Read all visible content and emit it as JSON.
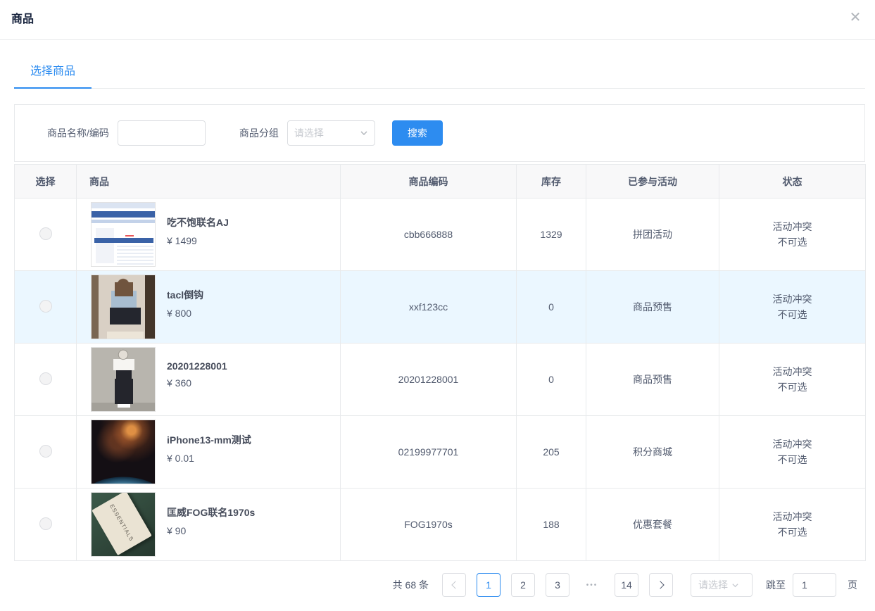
{
  "modal": {
    "title": "商品",
    "close_icon": "✕"
  },
  "tabs": [
    {
      "label": "选择商品",
      "active": true
    }
  ],
  "filters": {
    "name_label": "商品名称/编码",
    "name_value": "",
    "group_label": "商品分组",
    "group_placeholder": "请选择",
    "search_label": "搜索"
  },
  "colors": {
    "primary": "#2d8cf0",
    "row_highlight": "#ebf7ff",
    "header_bg": "#f8f8f9",
    "border": "#e8eaec"
  },
  "table": {
    "columns": [
      "选择",
      "商品",
      "商品编码",
      "库存",
      "已参与活动",
      "状态"
    ],
    "rows": [
      {
        "name": "吃不饱联名AJ",
        "price": "¥ 1499",
        "code": "cbb666888",
        "stock": "1329",
        "activity": "拼团活动",
        "status": "活动冲突\n不可选",
        "image": "webpage-screenshot-thumbnail",
        "highlighted": false
      },
      {
        "name": "tacl倒钩",
        "price": "¥ 800",
        "code": "xxf123cc",
        "stock": "0",
        "activity": "商品预售",
        "status": "活动冲突\n不可选",
        "image": "girl-mirror-selfie-thumbnail",
        "highlighted": true
      },
      {
        "name": "20201228001",
        "price": "¥ 360",
        "code": "20201228001",
        "stock": "0",
        "activity": "商品预售",
        "status": "活动冲突\n不可选",
        "image": "black-overalls-outfit-thumbnail",
        "highlighted": false
      },
      {
        "name": "iPhone13-mm测试",
        "price": "¥ 0.01",
        "code": "02199977701",
        "stock": "205",
        "activity": "积分商城",
        "status": "活动冲突\n不可选",
        "image": "space-earth-thumbnail",
        "highlighted": false
      },
      {
        "name": "匡威FOG联名1970s",
        "price": "¥ 90",
        "code": "FOG1970s",
        "stock": "188",
        "activity": "优惠套餐",
        "status": "活动冲突\n不可选",
        "image": "essentials-tag-thumbnail",
        "image_text": "ESSENTIALS",
        "highlighted": false
      }
    ]
  },
  "pagination": {
    "total": "共 68 条",
    "pages": [
      "1",
      "2",
      "3",
      "14"
    ],
    "current": "1",
    "ellipsis": "•••",
    "page_size_placeholder": "请选择",
    "jump_label": "跳至",
    "jump_value": "1",
    "page_unit": "页"
  }
}
